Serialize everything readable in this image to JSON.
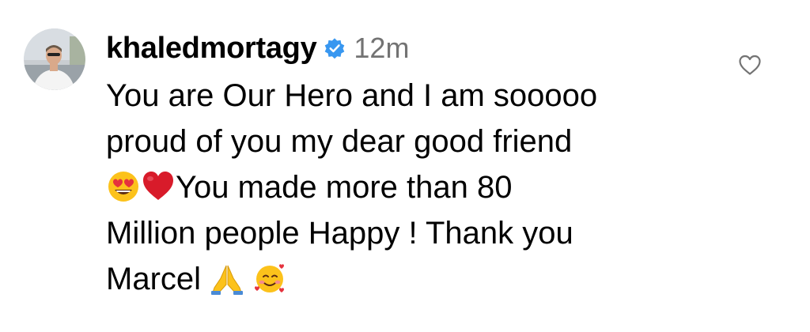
{
  "comment": {
    "username": "khaledmortagy",
    "timestamp": "12m",
    "verified_icon": "verified-badge-icon",
    "text_lines": [
      "You are Our Hero and I am sooooo",
      "proud of you my dear good friend",
      "You made more than 80",
      "Million people Happy ! Thank you",
      "Marcel"
    ],
    "emojis": {
      "heart_eyes": "smiling-face-with-heart-eyes",
      "red_heart": "red-heart",
      "folded_hands": "folded-hands",
      "hearts_face": "smiling-face-with-hearts"
    },
    "like_icon": "heart-outline-icon"
  },
  "colors": {
    "text": "#000000",
    "secondary": "#737373",
    "verified": "#3897f0"
  }
}
